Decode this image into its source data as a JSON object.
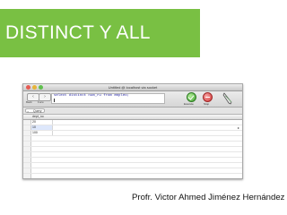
{
  "slide": {
    "title": "DISTINCT Y ALL",
    "author": "Profr. Victor Ahmed Jiménez Hernández",
    "accent_color": "#79c043"
  },
  "window": {
    "title": "Untitled @ localhost via socket"
  },
  "toolbar": {
    "back_label": "Back",
    "forward_label": "Forw",
    "query": "select distinct num_ru from empleo;",
    "execute_label": "Execute",
    "stop_label": "Stop",
    "tool_icon": "pen-icon"
  },
  "tabs": [
    {
      "label": "Query"
    }
  ],
  "results": {
    "columns": [
      "dept_no"
    ],
    "rows": [
      {
        "value": "20"
      },
      {
        "value": "10"
      },
      {
        "value": "100"
      }
    ]
  }
}
